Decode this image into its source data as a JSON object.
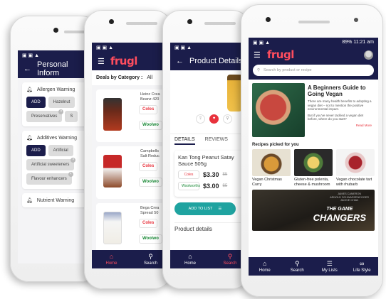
{
  "colors": {
    "navy": "#1b1d4b",
    "brand_red": "#ff4d5e",
    "coles_red": "#e8323c",
    "woolworths_green": "#1a8a37",
    "teal": "#1fa3a0"
  },
  "screen1": {
    "title": "Personal Inform",
    "back_icon": "back-arrow-icon",
    "sections": [
      {
        "label": "Allergen Warning",
        "chips": [
          "ADD",
          "Hazelnut",
          "Preservatives",
          "S"
        ]
      },
      {
        "label": "Additives Warning",
        "chips": [
          "ADD",
          "Artificial",
          "Artificial sweeteners",
          "Flavour enhancers"
        ]
      },
      {
        "label": "Nutrient Warning"
      }
    ]
  },
  "screen2": {
    "brand": "frugl",
    "deals_label": "Deals by Category :",
    "deals_value": "All",
    "products": [
      {
        "name_line1": "Heinz Crea",
        "name_line2": "Beanz 420",
        "store1": "Coles",
        "store2": "Woolwo"
      },
      {
        "name_line1": "Campbells",
        "name_line2": "Salt Reduc",
        "store1": "Coles",
        "store2": "Woolwo"
      },
      {
        "name_line1": "Bega Crea",
        "name_line2": "Spread 50",
        "store1": "Coles",
        "store2": "Woolwo"
      }
    ],
    "nav": [
      "Home",
      "Search"
    ]
  },
  "screen3": {
    "title": "Product Details",
    "tabs": [
      "DETAILS",
      "REVIEWS"
    ],
    "product_name": "Kan Tong Peanut Satay Sauce 505g",
    "rows": [
      {
        "store": "Coles",
        "price": "$3.30",
        "was": "$5"
      },
      {
        "store": "Woolworths",
        "price": "$3.00",
        "was": "$5"
      }
    ],
    "add_button": "ADD TO LIST",
    "section": "Product details",
    "nav": [
      "Home",
      "Search"
    ]
  },
  "screen4": {
    "status_right": "89% 11:21 am",
    "brand": "frugl",
    "search_placeholder": "Search by product or recipe",
    "featured": {
      "title": "A Beginners Guide to Going Vegan",
      "body1": "There are many health benefits to adopting a vegan diet – not to mention the positive environmental impact.",
      "body2": "But if you've never tackled a vegan diet before, where do you start?",
      "read_more": "Read More"
    },
    "picked_label": "Recipes picked for you",
    "recipes": [
      "Vegan Christmas Curry",
      "Gluten-free polenta, cheese & mushroom",
      "Vegan chocolate tart with rhubarb"
    ],
    "banner_small_1": "JAMES CAMERON",
    "banner_small_2": "ARNOLD SCHWARZENEGGER",
    "banner_small_3": "JACKIE CHAN",
    "banner_title_1": "THE GAME",
    "banner_title_2": "CHANGERS",
    "nav": [
      "Home",
      "Search",
      "My Lists",
      "Life Style"
    ]
  }
}
